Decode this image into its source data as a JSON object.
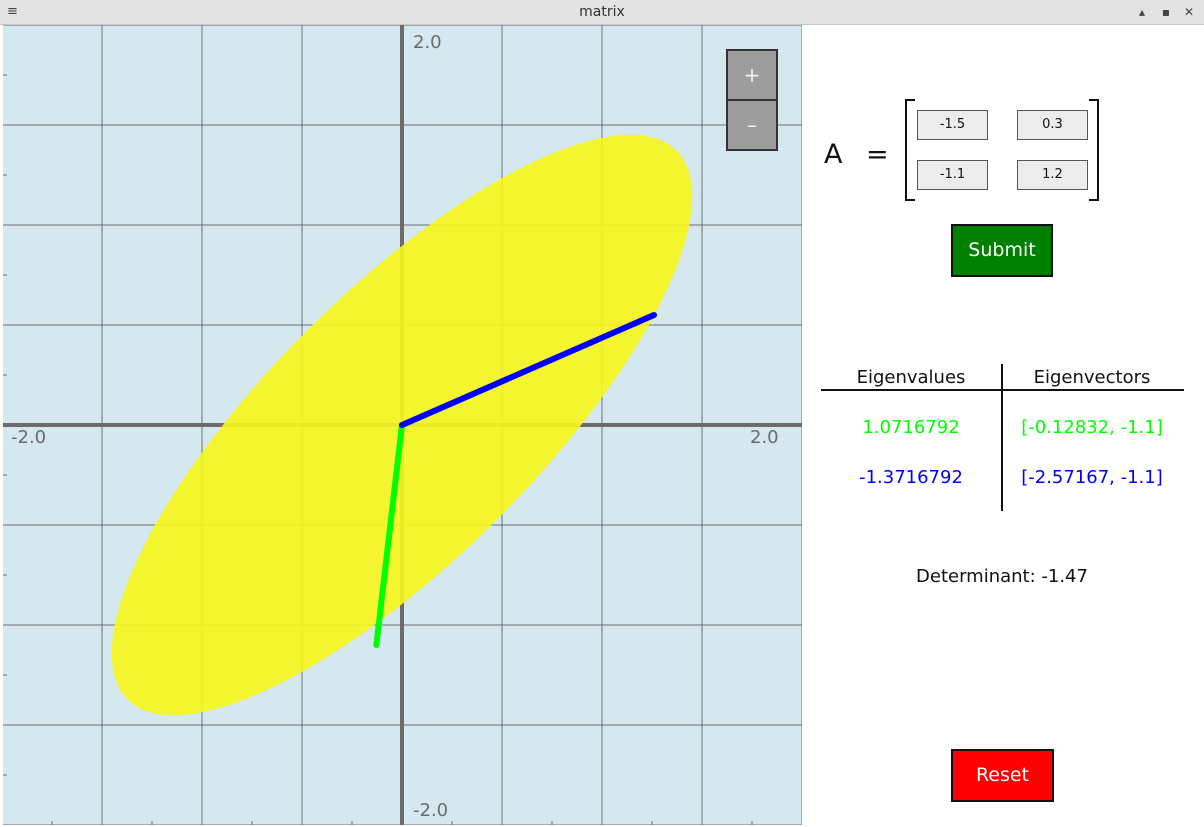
{
  "window": {
    "title": "matrix",
    "menu_icon": "hamburger-icon",
    "controls": {
      "minimize": "▴",
      "maximize": "▪",
      "close": "✕"
    }
  },
  "plot": {
    "y_max_label": "2.0",
    "y_min_label": "-2.0",
    "x_min_label": "-2.0",
    "x_max_label": "2.0",
    "colors": {
      "background": "#d5e8ef",
      "ellipse": "#f5f51f",
      "eigenvector_1": "#00ff00",
      "eigenvector_2": "#0000ff",
      "grid": "#6e6e6e"
    },
    "eigenvector_1": [
      -0.12832,
      -1.1
    ],
    "eigenvector_2": [
      1.26,
      0.55
    ],
    "ellipse": {
      "center": [
        0,
        0
      ],
      "rx": 1.94,
      "ry": 0.67,
      "rotation_deg": 45
    }
  },
  "zoom": {
    "in_label": "+",
    "out_label": "–"
  },
  "matrix": {
    "label": "A",
    "equals": "=",
    "cells": [
      "-1.5",
      "0.3",
      "-1.1",
      "1.2"
    ]
  },
  "submit_label": "Submit",
  "table": {
    "headers": [
      "Eigenvalues",
      "Eigenvectors"
    ],
    "rows": [
      {
        "value": "1.0716792",
        "vector": "[-0.12832, -1.1]",
        "color": "#00ff00"
      },
      {
        "value": "-1.3716792",
        "vector": "[-2.57167, -1.1]",
        "color": "#0000ff"
      }
    ]
  },
  "determinant_text": "Determinant: -1.47",
  "reset_label": "Reset"
}
